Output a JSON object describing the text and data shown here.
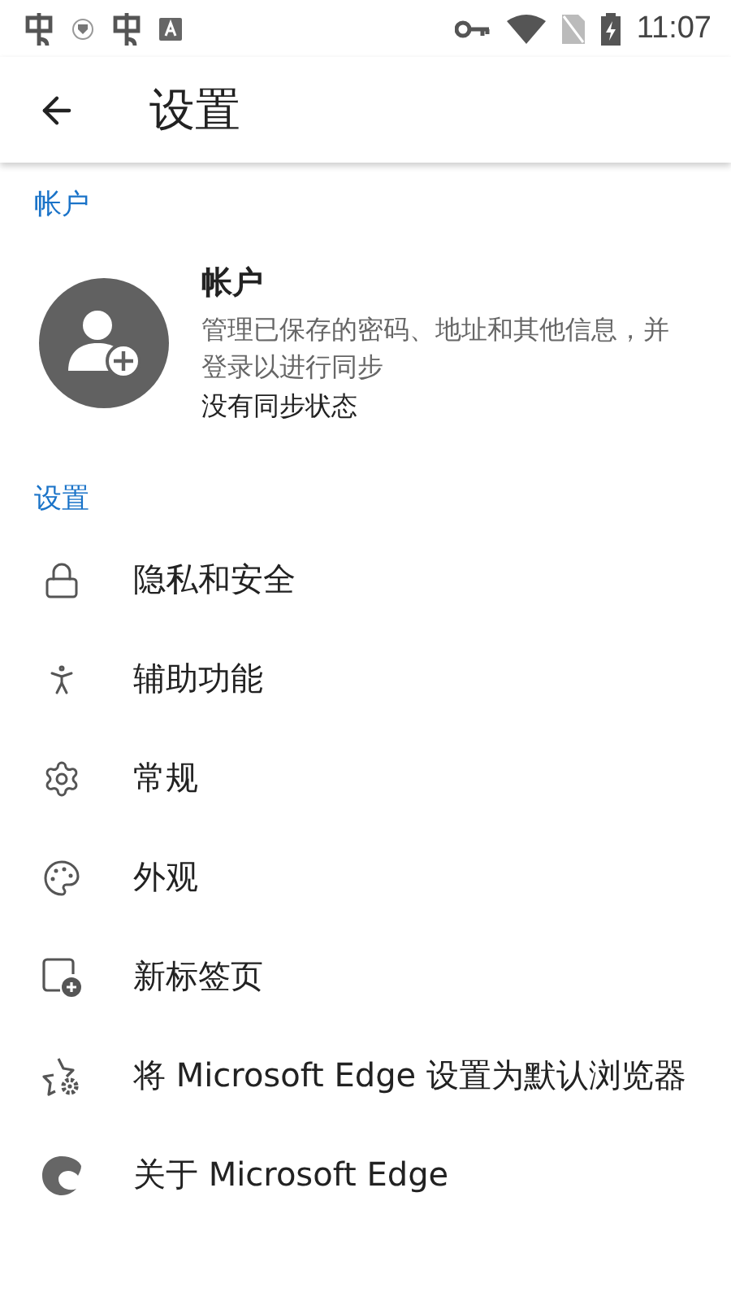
{
  "status_bar": {
    "time": "11:07"
  },
  "toolbar": {
    "title": "设置"
  },
  "account_section": {
    "header": "帐户",
    "title": "帐户",
    "description": "管理已保存的密码、地址和其他信息，并登录以进行同步",
    "sync_status": "没有同步状态"
  },
  "settings_section": {
    "header": "设置",
    "items": [
      {
        "kind": "lock",
        "label": "隐私和安全"
      },
      {
        "kind": "person",
        "label": "辅助功能"
      },
      {
        "kind": "gear",
        "label": "常规"
      },
      {
        "kind": "palette",
        "label": "外观"
      },
      {
        "kind": "newtab",
        "label": "新标签页"
      },
      {
        "kind": "star",
        "label": "将 Microsoft Edge 设置为默认浏览器"
      },
      {
        "kind": "edge",
        "label": "关于 Microsoft Edge"
      }
    ]
  }
}
